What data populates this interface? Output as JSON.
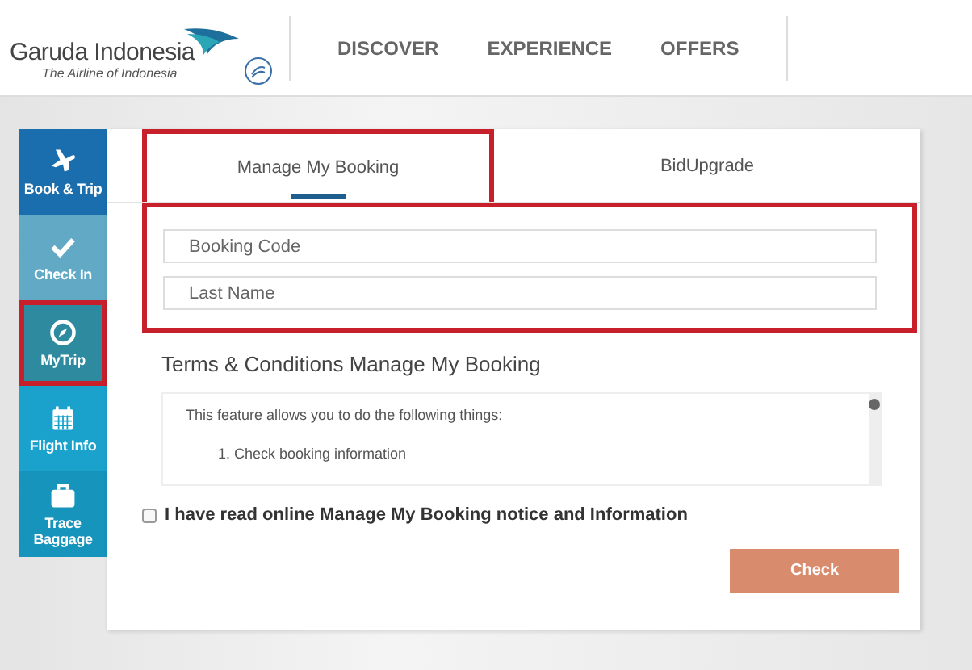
{
  "header": {
    "brand": "Garuda Indonesia",
    "tagline": "The Airline of Indonesia",
    "nav": [
      "DISCOVER",
      "EXPERIENCE",
      "OFFERS"
    ]
  },
  "sidebar": {
    "items": [
      {
        "label": "Book & Trip",
        "kind": "plane",
        "color": "#1b6eae",
        "highlighted": false
      },
      {
        "label": "Check In",
        "kind": "check",
        "color": "#62a9c6",
        "highlighted": false
      },
      {
        "label": "MyTrip",
        "kind": "compass",
        "color": "#2e8a9e",
        "highlighted": true
      },
      {
        "label": "Flight Info",
        "kind": "calendar",
        "color": "#1ba2cc",
        "highlighted": false
      },
      {
        "label": "Trace Baggage",
        "kind": "bag",
        "color": "#1694bb",
        "highlighted": false
      }
    ]
  },
  "tabs": [
    {
      "label": "Manage My Booking",
      "selected": true,
      "highlighted": true
    },
    {
      "label": "BidUpgrade",
      "selected": false,
      "highlighted": false
    }
  ],
  "form": {
    "highlighted": true,
    "fields": [
      {
        "placeholder": "Booking Code"
      },
      {
        "placeholder": "Last Name"
      }
    ]
  },
  "terms": {
    "title": "Terms & Conditions Manage My Booking",
    "lines": [
      "This feature allows you to do the following things:",
      "1. Check booking information"
    ]
  },
  "agree": {
    "label": "I have read online Manage My Booking notice and Information",
    "checked": false
  },
  "button": "Check"
}
